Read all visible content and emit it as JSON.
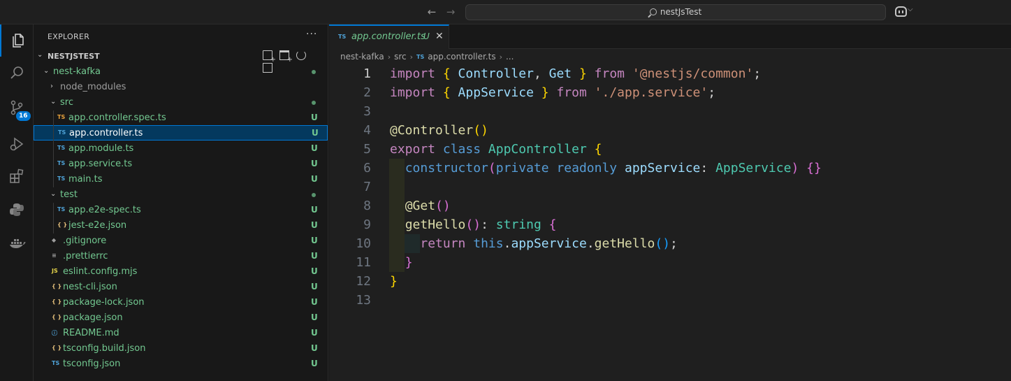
{
  "titlebar": {
    "back_arrow": "←",
    "forward_arrow": "→",
    "search_text": "nestJsTest",
    "copilot_chevron": "⌵"
  },
  "activity_bar": {
    "items": [
      {
        "name": "explorer",
        "icon": "files-icon",
        "active": true
      },
      {
        "name": "search",
        "icon": "search-icon"
      },
      {
        "name": "source-control",
        "icon": "source-control-icon",
        "badge": "16"
      },
      {
        "name": "run-debug",
        "icon": "run-debug-icon"
      },
      {
        "name": "extensions",
        "icon": "extensions-icon"
      },
      {
        "name": "python",
        "icon": "python-icon"
      },
      {
        "name": "docker",
        "icon": "docker-icon"
      }
    ]
  },
  "sidebar": {
    "title": "EXPLORER",
    "more": "···",
    "project": {
      "chevron": "⌄",
      "name": "NESTJSTEST"
    },
    "tree": [
      {
        "label": "nest-kafka",
        "type": "folder",
        "chevron": "⌄",
        "depth": 1,
        "mark": "dot",
        "color": "green"
      },
      {
        "label": "node_modules",
        "type": "folder",
        "chevron": "›",
        "depth": 2,
        "color": "gray"
      },
      {
        "label": "src",
        "type": "folder",
        "chevron": "⌄",
        "depth": 2,
        "mark": "dot",
        "color": "green"
      },
      {
        "label": "app.controller.spec.ts",
        "type": "file",
        "icon": "TS",
        "iconColor": "spec",
        "depth": 3,
        "status": "U",
        "color": "green"
      },
      {
        "label": "app.controller.ts",
        "type": "file",
        "icon": "TS",
        "iconColor": "ts",
        "depth": 3,
        "status": "U",
        "color": "white",
        "selected": true
      },
      {
        "label": "app.module.ts",
        "type": "file",
        "icon": "TS",
        "iconColor": "ts",
        "depth": 3,
        "status": "U",
        "color": "green"
      },
      {
        "label": "app.service.ts",
        "type": "file",
        "icon": "TS",
        "iconColor": "ts",
        "depth": 3,
        "status": "U",
        "color": "green"
      },
      {
        "label": "main.ts",
        "type": "file",
        "icon": "TS",
        "iconColor": "ts",
        "depth": 3,
        "status": "U",
        "color": "green"
      },
      {
        "label": "test",
        "type": "folder",
        "chevron": "⌄",
        "depth": 2,
        "mark": "dot",
        "color": "green"
      },
      {
        "label": "app.e2e-spec.ts",
        "type": "file",
        "icon": "TS",
        "iconColor": "ts",
        "depth": 3,
        "status": "U",
        "color": "green"
      },
      {
        "label": "jest-e2e.json",
        "type": "file",
        "icon": "{ }",
        "iconColor": "json",
        "depth": 3,
        "status": "U",
        "color": "green"
      },
      {
        "label": ".gitignore",
        "type": "file",
        "icon": "◆",
        "iconColor": "gray",
        "depth": 2,
        "status": "U",
        "color": "green"
      },
      {
        "label": ".prettierrc",
        "type": "file",
        "icon": "≡",
        "iconColor": "gray",
        "depth": 2,
        "status": "U",
        "color": "green"
      },
      {
        "label": "eslint.config.mjs",
        "type": "file",
        "icon": "JS",
        "iconColor": "js",
        "depth": 2,
        "status": "U",
        "color": "green"
      },
      {
        "label": "nest-cli.json",
        "type": "file",
        "icon": "{ }",
        "iconColor": "json",
        "depth": 2,
        "status": "U",
        "color": "green"
      },
      {
        "label": "package-lock.json",
        "type": "file",
        "icon": "{ }",
        "iconColor": "json",
        "depth": 2,
        "status": "U",
        "color": "green"
      },
      {
        "label": "package.json",
        "type": "file",
        "icon": "{ }",
        "iconColor": "json",
        "depth": 2,
        "status": "U",
        "color": "green"
      },
      {
        "label": "README.md",
        "type": "file",
        "icon": "ⓘ",
        "iconColor": "ts",
        "depth": 2,
        "status": "U",
        "color": "green"
      },
      {
        "label": "tsconfig.build.json",
        "type": "file",
        "icon": "{ }",
        "iconColor": "json",
        "depth": 2,
        "status": "U",
        "color": "green"
      },
      {
        "label": "tsconfig.json",
        "type": "file",
        "icon": "TS",
        "iconColor": "ts",
        "depth": 2,
        "status": "U",
        "color": "green"
      }
    ]
  },
  "editor": {
    "tab": {
      "icon": "TS",
      "name": "app.controller.ts",
      "status": "U",
      "close": "✕"
    },
    "breadcrumb": [
      "nest-kafka",
      "src",
      "app.controller.ts",
      "..."
    ],
    "current_line": 1,
    "lines": [
      [
        [
          "import",
          "ctrl"
        ],
        [
          " ",
          "plain"
        ],
        [
          "{",
          "b1"
        ],
        [
          " Controller",
          "var"
        ],
        [
          ",",
          "plain"
        ],
        [
          " Get",
          "var"
        ],
        [
          " ",
          "plain"
        ],
        [
          "}",
          "b1"
        ],
        [
          " ",
          "plain"
        ],
        [
          "from",
          "ctrl"
        ],
        [
          " ",
          "plain"
        ],
        [
          "'@nestjs/common'",
          "str"
        ],
        [
          ";",
          "plain"
        ]
      ],
      [
        [
          "import",
          "ctrl"
        ],
        [
          " ",
          "plain"
        ],
        [
          "{",
          "b1"
        ],
        [
          " AppService",
          "var"
        ],
        [
          " ",
          "plain"
        ],
        [
          "}",
          "b1"
        ],
        [
          " ",
          "plain"
        ],
        [
          "from",
          "ctrl"
        ],
        [
          " ",
          "plain"
        ],
        [
          "'./app.service'",
          "str"
        ],
        [
          ";",
          "plain"
        ]
      ],
      [],
      [
        [
          "@Controller",
          "fn"
        ],
        [
          "(",
          "b1"
        ],
        [
          ")",
          "b1"
        ]
      ],
      [
        [
          "export",
          "ctrl"
        ],
        [
          " ",
          "plain"
        ],
        [
          "class",
          "kw"
        ],
        [
          " ",
          "plain"
        ],
        [
          "AppController",
          "type"
        ],
        [
          " ",
          "plain"
        ],
        [
          "{",
          "b1"
        ]
      ],
      [
        [
          "  ",
          "plain"
        ],
        [
          "constructor",
          "kw"
        ],
        [
          "(",
          "b2"
        ],
        [
          "private",
          "kw"
        ],
        [
          " ",
          "plain"
        ],
        [
          "readonly",
          "kw"
        ],
        [
          " ",
          "plain"
        ],
        [
          "appService",
          "var"
        ],
        [
          ": ",
          "plain"
        ],
        [
          "AppService",
          "type"
        ],
        [
          ")",
          "b2"
        ],
        [
          " ",
          "plain"
        ],
        [
          "{}",
          "b2"
        ]
      ],
      [],
      [
        [
          "  ",
          "plain"
        ],
        [
          "@Get",
          "fn"
        ],
        [
          "(",
          "b2"
        ],
        [
          ")",
          "b2"
        ]
      ],
      [
        [
          "  ",
          "plain"
        ],
        [
          "getHello",
          "fn"
        ],
        [
          "(",
          "b2"
        ],
        [
          ")",
          "b2"
        ],
        [
          ": ",
          "plain"
        ],
        [
          "string",
          "type"
        ],
        [
          " ",
          "plain"
        ],
        [
          "{",
          "b2"
        ]
      ],
      [
        [
          "    ",
          "plain"
        ],
        [
          "return",
          "ctrl"
        ],
        [
          " ",
          "plain"
        ],
        [
          "this",
          "kw"
        ],
        [
          ".",
          "plain"
        ],
        [
          "appService",
          "var"
        ],
        [
          ".",
          "plain"
        ],
        [
          "getHello",
          "fn"
        ],
        [
          "(",
          "b3"
        ],
        [
          ")",
          "b3"
        ],
        [
          ";",
          "plain"
        ]
      ],
      [
        [
          "  ",
          "plain"
        ],
        [
          "}",
          "b2"
        ]
      ],
      [
        [
          "}",
          "b1"
        ]
      ],
      []
    ]
  }
}
